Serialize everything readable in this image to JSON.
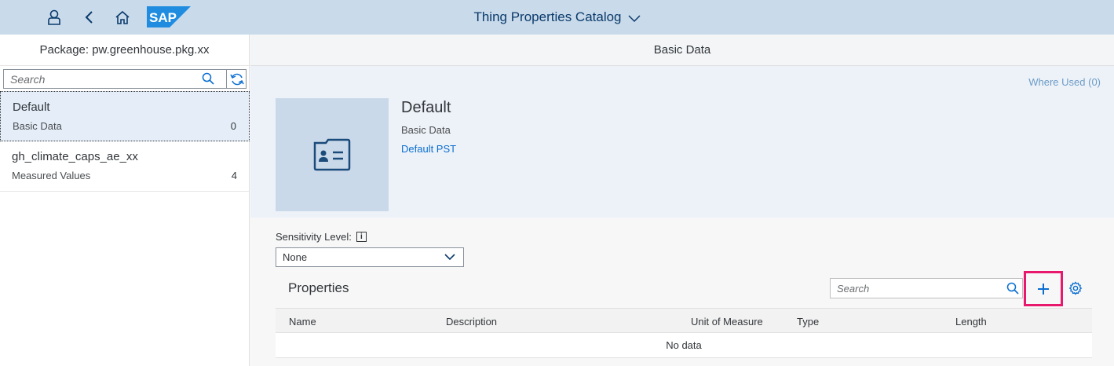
{
  "shell": {
    "title": "Thing Properties Catalog",
    "logo_text": "SAP",
    "icons": [
      "user-icon",
      "back-icon",
      "home-icon",
      "chevron-down-icon"
    ]
  },
  "master": {
    "header": "Package: pw.greenhouse.pkg.xx",
    "search_placeholder": "Search",
    "items": [
      {
        "title": "Default",
        "subtitle": "Basic Data",
        "count": "0"
      },
      {
        "title": "gh_climate_caps_ae_xx",
        "subtitle": "Measured Values",
        "count": "4"
      }
    ]
  },
  "detail": {
    "header": "Basic Data",
    "where_used": "Where Used (0)",
    "object": {
      "title": "Default",
      "subtitle": "Basic Data",
      "link": "Default PST"
    },
    "sensitivity": {
      "label": "Sensitivity Level:",
      "info_glyph": "i",
      "value": "None"
    },
    "properties": {
      "title": "Properties",
      "search_placeholder": "Search",
      "columns": [
        "Name",
        "Description",
        "Unit of Measure",
        "Type",
        "Length"
      ],
      "empty_text": "No data"
    }
  },
  "colors": {
    "shell_bg": "#c9daea",
    "accent": "#0a6ed1",
    "highlight": "#e8196d",
    "selected_item": "#e5eef8",
    "object_header_bg": "#edf2f8"
  }
}
